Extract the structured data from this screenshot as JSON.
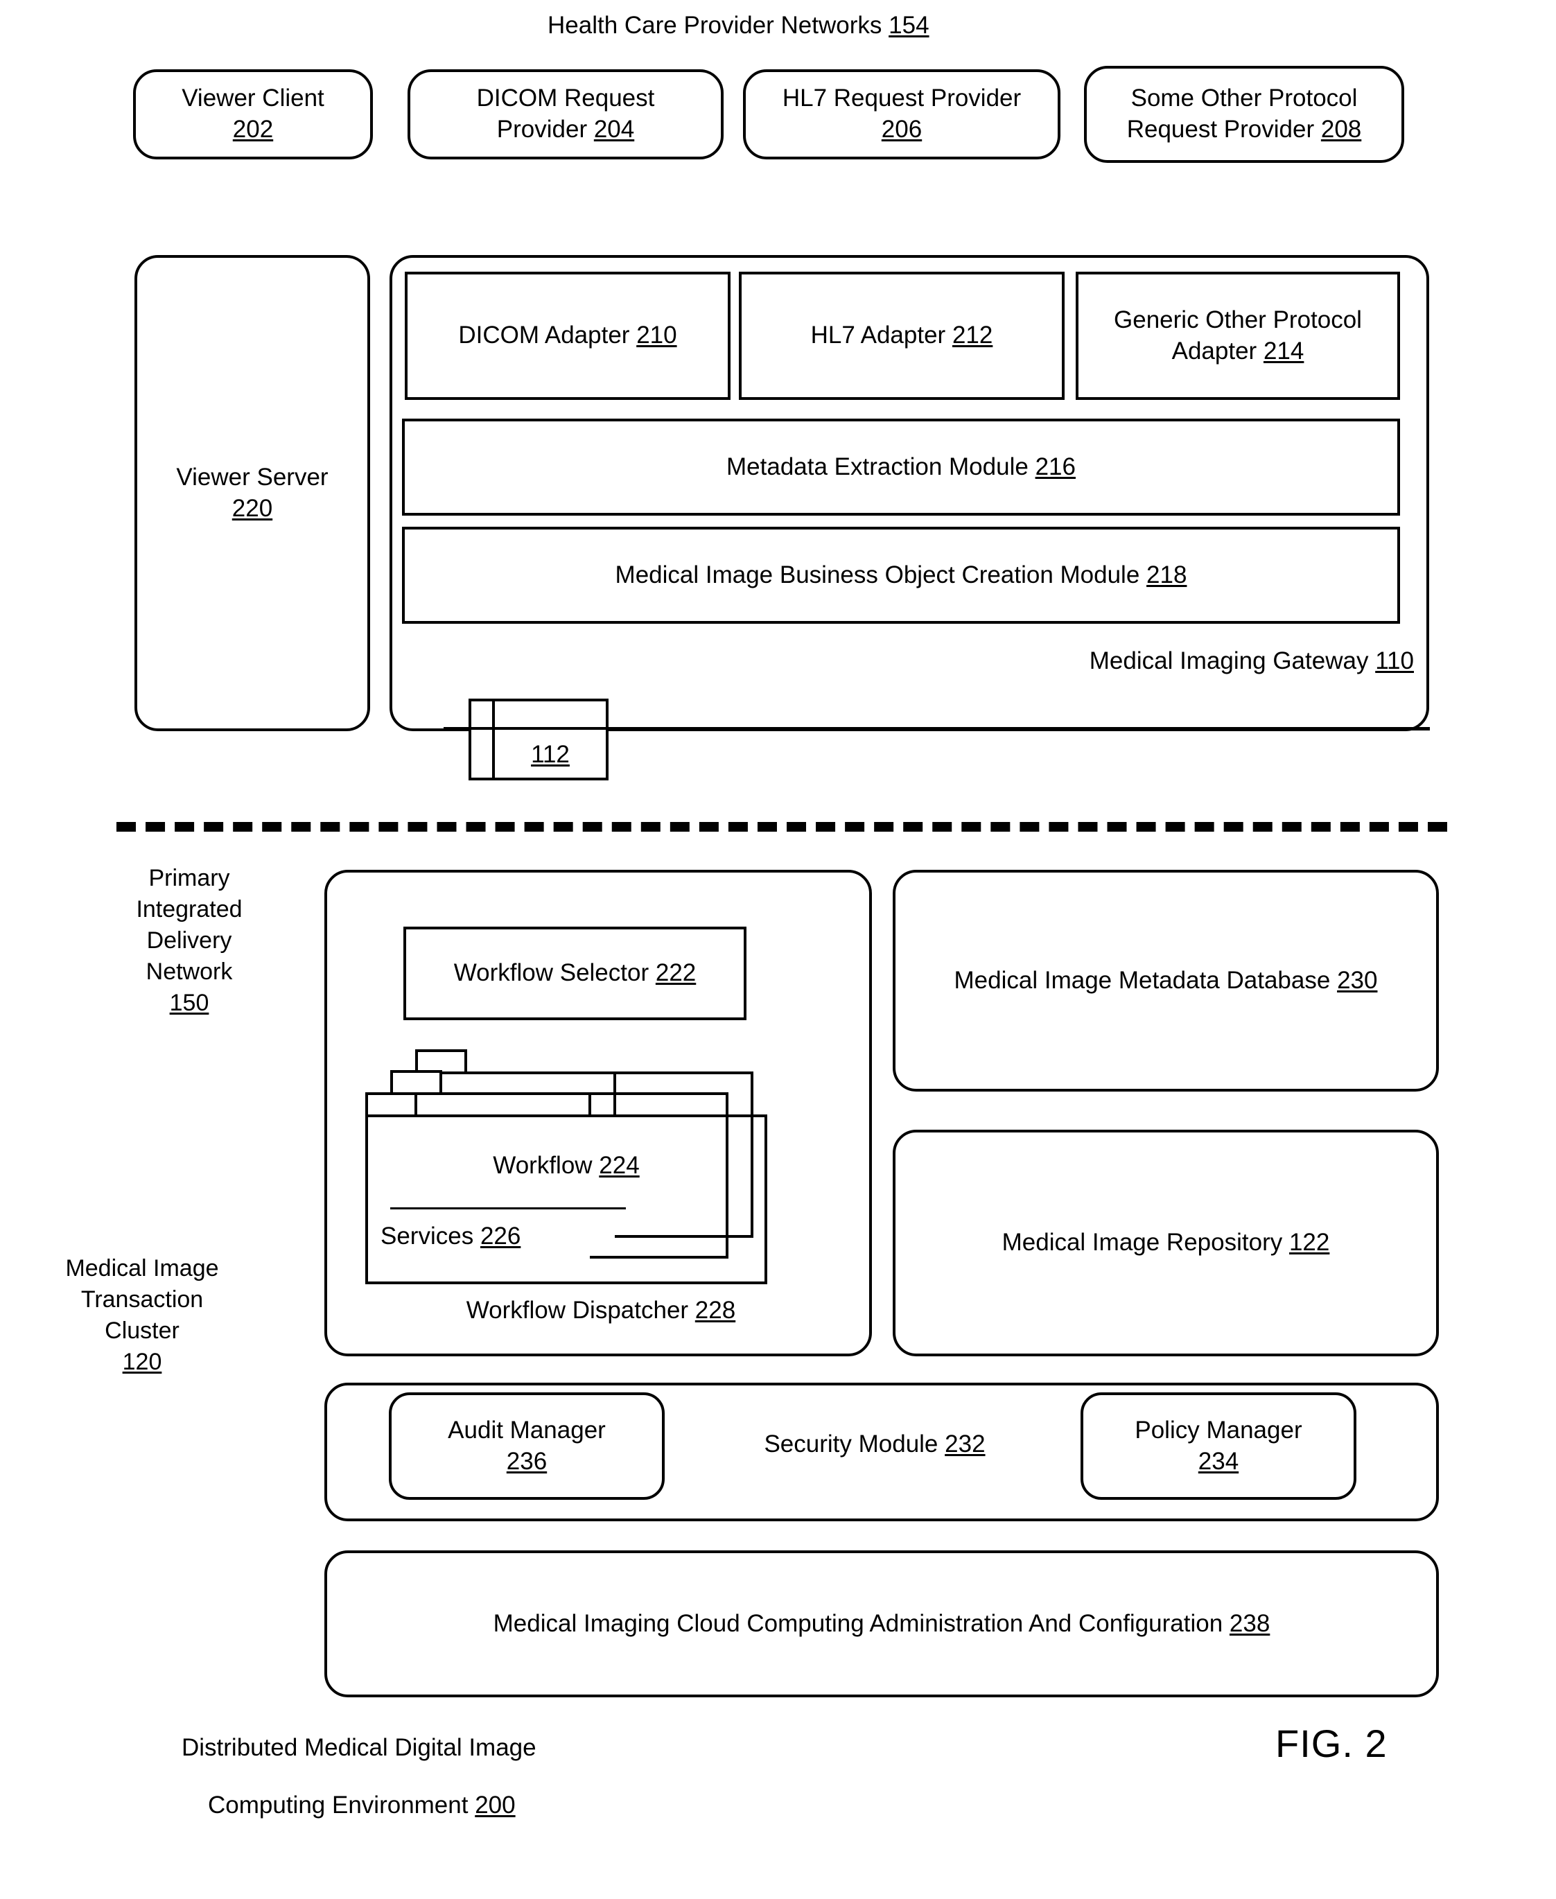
{
  "figure": {
    "number": "FIG. 2",
    "caption_line1": "Distributed Medical Digital Image",
    "caption_line2": "Computing Environment 200",
    "caption_line2_text": "Computing Environment",
    "caption_line2_ref": "200"
  },
  "top": {
    "title_text": "Health Care Provider Networks",
    "title_ref": "154",
    "providers": [
      {
        "line1": "Viewer Client",
        "line2": "",
        "ref": "202"
      },
      {
        "line1": "DICOM Request",
        "line2": "Provider",
        "ref": "204"
      },
      {
        "line1": "HL7 Request Provider",
        "line2": "",
        "ref": "206"
      },
      {
        "line1": "Some Other Protocol",
        "line2": "Request Provider",
        "ref": "208"
      }
    ]
  },
  "gateway": {
    "viewer_server": {
      "line1": "Viewer Server",
      "ref": "220"
    },
    "adapters": [
      {
        "line1": "DICOM Adapter",
        "line2": "",
        "ref": "210"
      },
      {
        "line1": "HL7 Adapter",
        "line2": "",
        "ref": "212"
      },
      {
        "line1": "Generic Other Protocol",
        "line2": "Adapter",
        "ref": "214"
      }
    ],
    "metadata_module": {
      "text": "Metadata Extraction Module",
      "ref": "216"
    },
    "business_object_module": {
      "text": "Medical Image Business Object Creation Module",
      "ref": "218"
    },
    "gateway_label": {
      "text": "Medical Imaging Gateway",
      "ref": "110"
    },
    "connector_ref": "112"
  },
  "bottom": {
    "network_label": {
      "line1": "Primary",
      "line2": "Integrated",
      "line3": "Delivery",
      "line4": "Network",
      "ref": "150"
    },
    "cluster_label": {
      "line1": "Medical Image",
      "line2": "Transaction",
      "line3": "Cluster",
      "ref": "120"
    },
    "workflow_selector": {
      "text": "Workflow Selector",
      "ref": "222"
    },
    "workflow": {
      "text": "Workflow",
      "ref": "224"
    },
    "services": {
      "text": "Services",
      "ref": "226"
    },
    "workflow_dispatcher": {
      "text": "Workflow Dispatcher",
      "ref": "228"
    },
    "metadata_database": {
      "text": "Medical Image Metadata Database",
      "ref": "230"
    },
    "image_repository": {
      "text": "Medical Image Repository",
      "ref": "122"
    },
    "security_module": {
      "text": "Security Module",
      "ref": "232"
    },
    "audit_manager": {
      "text": "Audit Manager",
      "ref": "236"
    },
    "policy_manager": {
      "text": "Policy Manager",
      "ref": "234"
    },
    "cloud_admin": {
      "text": "Medical Imaging Cloud Computing Administration And Configuration",
      "ref": "238"
    }
  },
  "colors": {
    "stroke": "#000000",
    "background": "#ffffff"
  }
}
